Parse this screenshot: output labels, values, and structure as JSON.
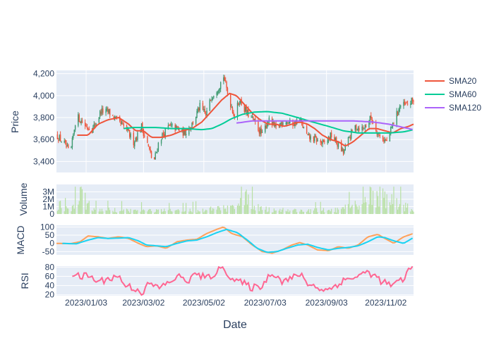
{
  "chart_data": {
    "type": "candlestick",
    "x_axis": {
      "title": "Date",
      "start": "2022-12-04",
      "end": "2023-11-30",
      "tick_labels": [
        "2023/01/03",
        "2023/03/02",
        "2023/05/02",
        "2023/07/03",
        "2023/09/03",
        "2023/11/02"
      ]
    },
    "price_axis": {
      "title": "Price",
      "range": [
        3300,
        4230
      ],
      "ticks": [
        3400,
        3600,
        3800,
        4000,
        4200
      ],
      "tick_labels": [
        "3,400",
        "3,600",
        "3,800",
        "4,000",
        "4,200"
      ]
    },
    "volume_axis": {
      "title": "Volume",
      "range": [
        0,
        4000000
      ],
      "ticks": [
        0,
        1000000,
        2000000,
        3000000
      ],
      "tick_labels": [
        "0",
        "1M",
        "2M",
        "3M"
      ]
    },
    "macd_axis": {
      "title": "MACD",
      "range": [
        -70,
        110
      ],
      "ticks": [
        -50,
        0,
        50,
        100
      ],
      "tick_labels": [
        "-50",
        "0",
        "50",
        "100"
      ]
    },
    "rsi_axis": {
      "title": "RSI",
      "range": [
        18,
        82
      ],
      "ticks": [
        20,
        40,
        60,
        80
      ],
      "tick_labels": [
        "20",
        "40",
        "60",
        "80"
      ]
    },
    "legend": {
      "placement": "top-right",
      "entries": [
        {
          "name": "SMA20",
          "color": "#ef553b"
        },
        {
          "name": "SMA60",
          "color": "#00cc96"
        },
        {
          "name": "SMA120",
          "color": "#ab63fa"
        }
      ]
    },
    "colors": {
      "increasing": "#3d9970",
      "decreasing": "#ef553b",
      "volume": "#b8e0a3",
      "macd_line": "#ffa15a",
      "signal_line": "#19d3f3",
      "rsi": "#ff6692",
      "plot_bg": "#e5ecf6",
      "grid": "#ffffff"
    },
    "price_path": [
      [
        "2022-12-04",
        3640
      ],
      [
        "2022-12-12",
        3560
      ],
      [
        "2022-12-18",
        3460
      ],
      [
        "2022-12-24",
        3820
      ],
      [
        "2023-01-03",
        3720
      ],
      [
        "2023-01-10",
        3700
      ],
      [
        "2023-01-18",
        3860
      ],
      [
        "2023-01-26",
        3850
      ],
      [
        "2023-02-04",
        3760
      ],
      [
        "2023-02-12",
        3700
      ],
      [
        "2023-02-20",
        3580
      ],
      [
        "2023-02-28",
        3720
      ],
      [
        "2023-03-06",
        3560
      ],
      [
        "2023-03-12",
        3380
      ],
      [
        "2023-03-18",
        3600
      ],
      [
        "2023-03-28",
        3720
      ],
      [
        "2023-04-05",
        3700
      ],
      [
        "2023-04-12",
        3660
      ],
      [
        "2023-04-20",
        3740
      ],
      [
        "2023-04-28",
        3900
      ],
      [
        "2023-05-04",
        3820
      ],
      [
        "2023-05-10",
        4000
      ],
      [
        "2023-05-17",
        4080
      ],
      [
        "2023-05-22",
        4180
      ],
      [
        "2023-05-27",
        3980
      ],
      [
        "2023-06-02",
        3820
      ],
      [
        "2023-06-07",
        3960
      ],
      [
        "2023-06-14",
        3850
      ],
      [
        "2023-06-22",
        3760
      ],
      [
        "2023-06-30",
        3640
      ],
      [
        "2023-07-06",
        3780
      ],
      [
        "2023-07-14",
        3700
      ],
      [
        "2023-07-22",
        3780
      ],
      [
        "2023-07-30",
        3740
      ],
      [
        "2023-08-07",
        3780
      ],
      [
        "2023-08-15",
        3620
      ],
      [
        "2023-08-23",
        3600
      ],
      [
        "2023-08-31",
        3560
      ],
      [
        "2023-09-08",
        3640
      ],
      [
        "2023-09-14",
        3560
      ],
      [
        "2023-09-20",
        3480
      ],
      [
        "2023-09-26",
        3620
      ],
      [
        "2023-10-02",
        3720
      ],
      [
        "2023-10-10",
        3700
      ],
      [
        "2023-10-18",
        3800
      ],
      [
        "2023-10-26",
        3640
      ],
      [
        "2023-11-03",
        3580
      ],
      [
        "2023-11-10",
        3760
      ],
      [
        "2023-11-16",
        3900
      ],
      [
        "2023-11-24",
        3920
      ],
      [
        "2023-11-30",
        3960
      ]
    ],
    "sma20": [
      [
        "2022-12-25",
        3640
      ],
      [
        "2023-01-05",
        3640
      ],
      [
        "2023-01-15",
        3740
      ],
      [
        "2023-01-25",
        3780
      ],
      [
        "2023-02-05",
        3800
      ],
      [
        "2023-02-15",
        3740
      ],
      [
        "2023-02-22",
        3680
      ],
      [
        "2023-03-02",
        3680
      ],
      [
        "2023-03-10",
        3620
      ],
      [
        "2023-03-20",
        3620
      ],
      [
        "2023-03-30",
        3640
      ],
      [
        "2023-04-10",
        3680
      ],
      [
        "2023-04-20",
        3700
      ],
      [
        "2023-04-30",
        3760
      ],
      [
        "2023-05-10",
        3860
      ],
      [
        "2023-05-20",
        3960
      ],
      [
        "2023-05-28",
        4020
      ],
      [
        "2023-06-04",
        4000
      ],
      [
        "2023-06-12",
        3920
      ],
      [
        "2023-06-20",
        3840
      ],
      [
        "2023-06-28",
        3780
      ],
      [
        "2023-07-06",
        3740
      ],
      [
        "2023-07-14",
        3740
      ],
      [
        "2023-07-22",
        3720
      ],
      [
        "2023-07-30",
        3740
      ],
      [
        "2023-08-07",
        3760
      ],
      [
        "2023-08-15",
        3740
      ],
      [
        "2023-08-22",
        3700
      ],
      [
        "2023-08-30",
        3640
      ],
      [
        "2023-09-07",
        3600
      ],
      [
        "2023-09-15",
        3580
      ],
      [
        "2023-09-22",
        3540
      ],
      [
        "2023-09-30",
        3580
      ],
      [
        "2023-10-08",
        3640
      ],
      [
        "2023-10-16",
        3700
      ],
      [
        "2023-10-24",
        3700
      ],
      [
        "2023-11-01",
        3680
      ],
      [
        "2023-11-09",
        3660
      ],
      [
        "2023-11-17",
        3700
      ],
      [
        "2023-11-25",
        3720
      ],
      [
        "2023-11-30",
        3740
      ]
    ],
    "sma60": [
      [
        "2023-02-10",
        3700
      ],
      [
        "2023-02-20",
        3710
      ],
      [
        "2023-03-02",
        3710
      ],
      [
        "2023-03-15",
        3710
      ],
      [
        "2023-03-30",
        3700
      ],
      [
        "2023-04-15",
        3700
      ],
      [
        "2023-04-30",
        3690
      ],
      [
        "2023-05-10",
        3700
      ],
      [
        "2023-05-20",
        3740
      ],
      [
        "2023-05-30",
        3790
      ],
      [
        "2023-06-10",
        3830
      ],
      [
        "2023-06-22",
        3850
      ],
      [
        "2023-07-05",
        3855
      ],
      [
        "2023-07-20",
        3840
      ],
      [
        "2023-08-05",
        3800
      ],
      [
        "2023-08-20",
        3760
      ],
      [
        "2023-09-05",
        3720
      ],
      [
        "2023-09-20",
        3680
      ],
      [
        "2023-10-05",
        3660
      ],
      [
        "2023-10-20",
        3660
      ],
      [
        "2023-11-05",
        3660
      ],
      [
        "2023-11-20",
        3670
      ],
      [
        "2023-11-30",
        3690
      ]
    ],
    "sma120": [
      [
        "2023-06-04",
        3750
      ],
      [
        "2023-06-20",
        3770
      ],
      [
        "2023-07-10",
        3770
      ],
      [
        "2023-08-01",
        3770
      ],
      [
        "2023-08-20",
        3770
      ],
      [
        "2023-09-10",
        3770
      ],
      [
        "2023-09-30",
        3770
      ],
      [
        "2023-10-20",
        3760
      ],
      [
        "2023-11-05",
        3740
      ],
      [
        "2023-11-20",
        3710
      ],
      [
        "2023-11-30",
        3690
      ]
    ],
    "macd": [
      [
        "2022-12-04",
        0
      ],
      [
        "2022-12-18",
        -2
      ],
      [
        "2022-12-28",
        10
      ],
      [
        "2023-01-05",
        45
      ],
      [
        "2023-01-15",
        40
      ],
      [
        "2023-01-25",
        30
      ],
      [
        "2023-02-05",
        40
      ],
      [
        "2023-02-15",
        30
      ],
      [
        "2023-02-25",
        0
      ],
      [
        "2023-03-05",
        -20
      ],
      [
        "2023-03-15",
        -15
      ],
      [
        "2023-03-25",
        -30
      ],
      [
        "2023-04-05",
        10
      ],
      [
        "2023-04-15",
        20
      ],
      [
        "2023-04-25",
        25
      ],
      [
        "2023-05-05",
        60
      ],
      [
        "2023-05-15",
        85
      ],
      [
        "2023-05-22",
        100
      ],
      [
        "2023-05-30",
        60
      ],
      [
        "2023-06-10",
        40
      ],
      [
        "2023-06-20",
        -10
      ],
      [
        "2023-06-30",
        -50
      ],
      [
        "2023-07-10",
        -60
      ],
      [
        "2023-07-20",
        -40
      ],
      [
        "2023-07-30",
        -10
      ],
      [
        "2023-08-07",
        5
      ],
      [
        "2023-08-15",
        -10
      ],
      [
        "2023-08-25",
        -40
      ],
      [
        "2023-09-05",
        -45
      ],
      [
        "2023-09-15",
        -20
      ],
      [
        "2023-09-25",
        -30
      ],
      [
        "2023-10-05",
        -10
      ],
      [
        "2023-10-15",
        40
      ],
      [
        "2023-10-25",
        55
      ],
      [
        "2023-11-01",
        30
      ],
      [
        "2023-11-10",
        0
      ],
      [
        "2023-11-20",
        40
      ],
      [
        "2023-11-30",
        60
      ]
    ],
    "signal": [
      [
        "2022-12-10",
        0
      ],
      [
        "2022-12-24",
        -3
      ],
      [
        "2023-01-05",
        20
      ],
      [
        "2023-01-15",
        35
      ],
      [
        "2023-01-25",
        30
      ],
      [
        "2023-02-05",
        32
      ],
      [
        "2023-02-15",
        35
      ],
      [
        "2023-02-25",
        15
      ],
      [
        "2023-03-05",
        -10
      ],
      [
        "2023-03-15",
        -15
      ],
      [
        "2023-03-25",
        -20
      ],
      [
        "2023-04-05",
        0
      ],
      [
        "2023-04-15",
        15
      ],
      [
        "2023-04-25",
        20
      ],
      [
        "2023-05-05",
        40
      ],
      [
        "2023-05-15",
        65
      ],
      [
        "2023-05-25",
        85
      ],
      [
        "2023-06-05",
        65
      ],
      [
        "2023-06-15",
        20
      ],
      [
        "2023-06-25",
        -30
      ],
      [
        "2023-07-05",
        -55
      ],
      [
        "2023-07-15",
        -50
      ],
      [
        "2023-07-25",
        -30
      ],
      [
        "2023-08-05",
        -10
      ],
      [
        "2023-08-15",
        -5
      ],
      [
        "2023-08-25",
        -25
      ],
      [
        "2023-09-05",
        -40
      ],
      [
        "2023-09-15",
        -30
      ],
      [
        "2023-09-25",
        -25
      ],
      [
        "2023-10-05",
        -15
      ],
      [
        "2023-10-15",
        10
      ],
      [
        "2023-10-25",
        40
      ],
      [
        "2023-11-01",
        35
      ],
      [
        "2023-11-10",
        15
      ],
      [
        "2023-11-20",
        0
      ],
      [
        "2023-11-30",
        35
      ]
    ],
    "rsi": [
      [
        "2022-12-20",
        65
      ],
      [
        "2022-12-28",
        58
      ],
      [
        "2023-01-05",
        62
      ],
      [
        "2023-01-15",
        48
      ],
      [
        "2023-01-25",
        55
      ],
      [
        "2023-02-05",
        60
      ],
      [
        "2023-02-12",
        40
      ],
      [
        "2023-02-20",
        35
      ],
      [
        "2023-03-01",
        25
      ],
      [
        "2023-03-08",
        45
      ],
      [
        "2023-03-15",
        35
      ],
      [
        "2023-03-25",
        42
      ],
      [
        "2023-04-05",
        60
      ],
      [
        "2023-04-15",
        50
      ],
      [
        "2023-04-25",
        65
      ],
      [
        "2023-05-05",
        55
      ],
      [
        "2023-05-12",
        65
      ],
      [
        "2023-05-22",
        80
      ],
      [
        "2023-05-30",
        55
      ],
      [
        "2023-06-10",
        45
      ],
      [
        "2023-06-20",
        35
      ],
      [
        "2023-06-30",
        40
      ],
      [
        "2023-07-10",
        70
      ],
      [
        "2023-07-20",
        50
      ],
      [
        "2023-07-30",
        55
      ],
      [
        "2023-08-07",
        65
      ],
      [
        "2023-08-15",
        45
      ],
      [
        "2023-08-25",
        35
      ],
      [
        "2023-09-05",
        30
      ],
      [
        "2023-09-15",
        45
      ],
      [
        "2023-09-25",
        55
      ],
      [
        "2023-10-05",
        60
      ],
      [
        "2023-10-15",
        70
      ],
      [
        "2023-10-25",
        55
      ],
      [
        "2023-11-01",
        45
      ],
      [
        "2023-11-10",
        40
      ],
      [
        "2023-11-20",
        55
      ],
      [
        "2023-11-26",
        75
      ],
      [
        "2023-11-30",
        80
      ]
    ],
    "volume_profile": [
      [
        "2022-12-04",
        500000
      ],
      [
        "2022-12-20",
        900000
      ],
      [
        "2022-12-24",
        3600000
      ],
      [
        "2023-01-10",
        600000
      ],
      [
        "2023-02-01",
        600000
      ],
      [
        "2023-03-15",
        500000
      ],
      [
        "2023-04-15",
        500000
      ],
      [
        "2023-05-20",
        800000
      ],
      [
        "2023-06-01",
        1000000
      ],
      [
        "2023-06-05",
        3000000
      ],
      [
        "2023-07-01",
        700000
      ],
      [
        "2023-08-10",
        500000
      ],
      [
        "2023-09-15",
        600000
      ],
      [
        "2023-10-10",
        1500000
      ],
      [
        "2023-10-20",
        3000000
      ],
      [
        "2023-11-20",
        1200000
      ],
      [
        "2023-11-30",
        600000
      ]
    ]
  }
}
